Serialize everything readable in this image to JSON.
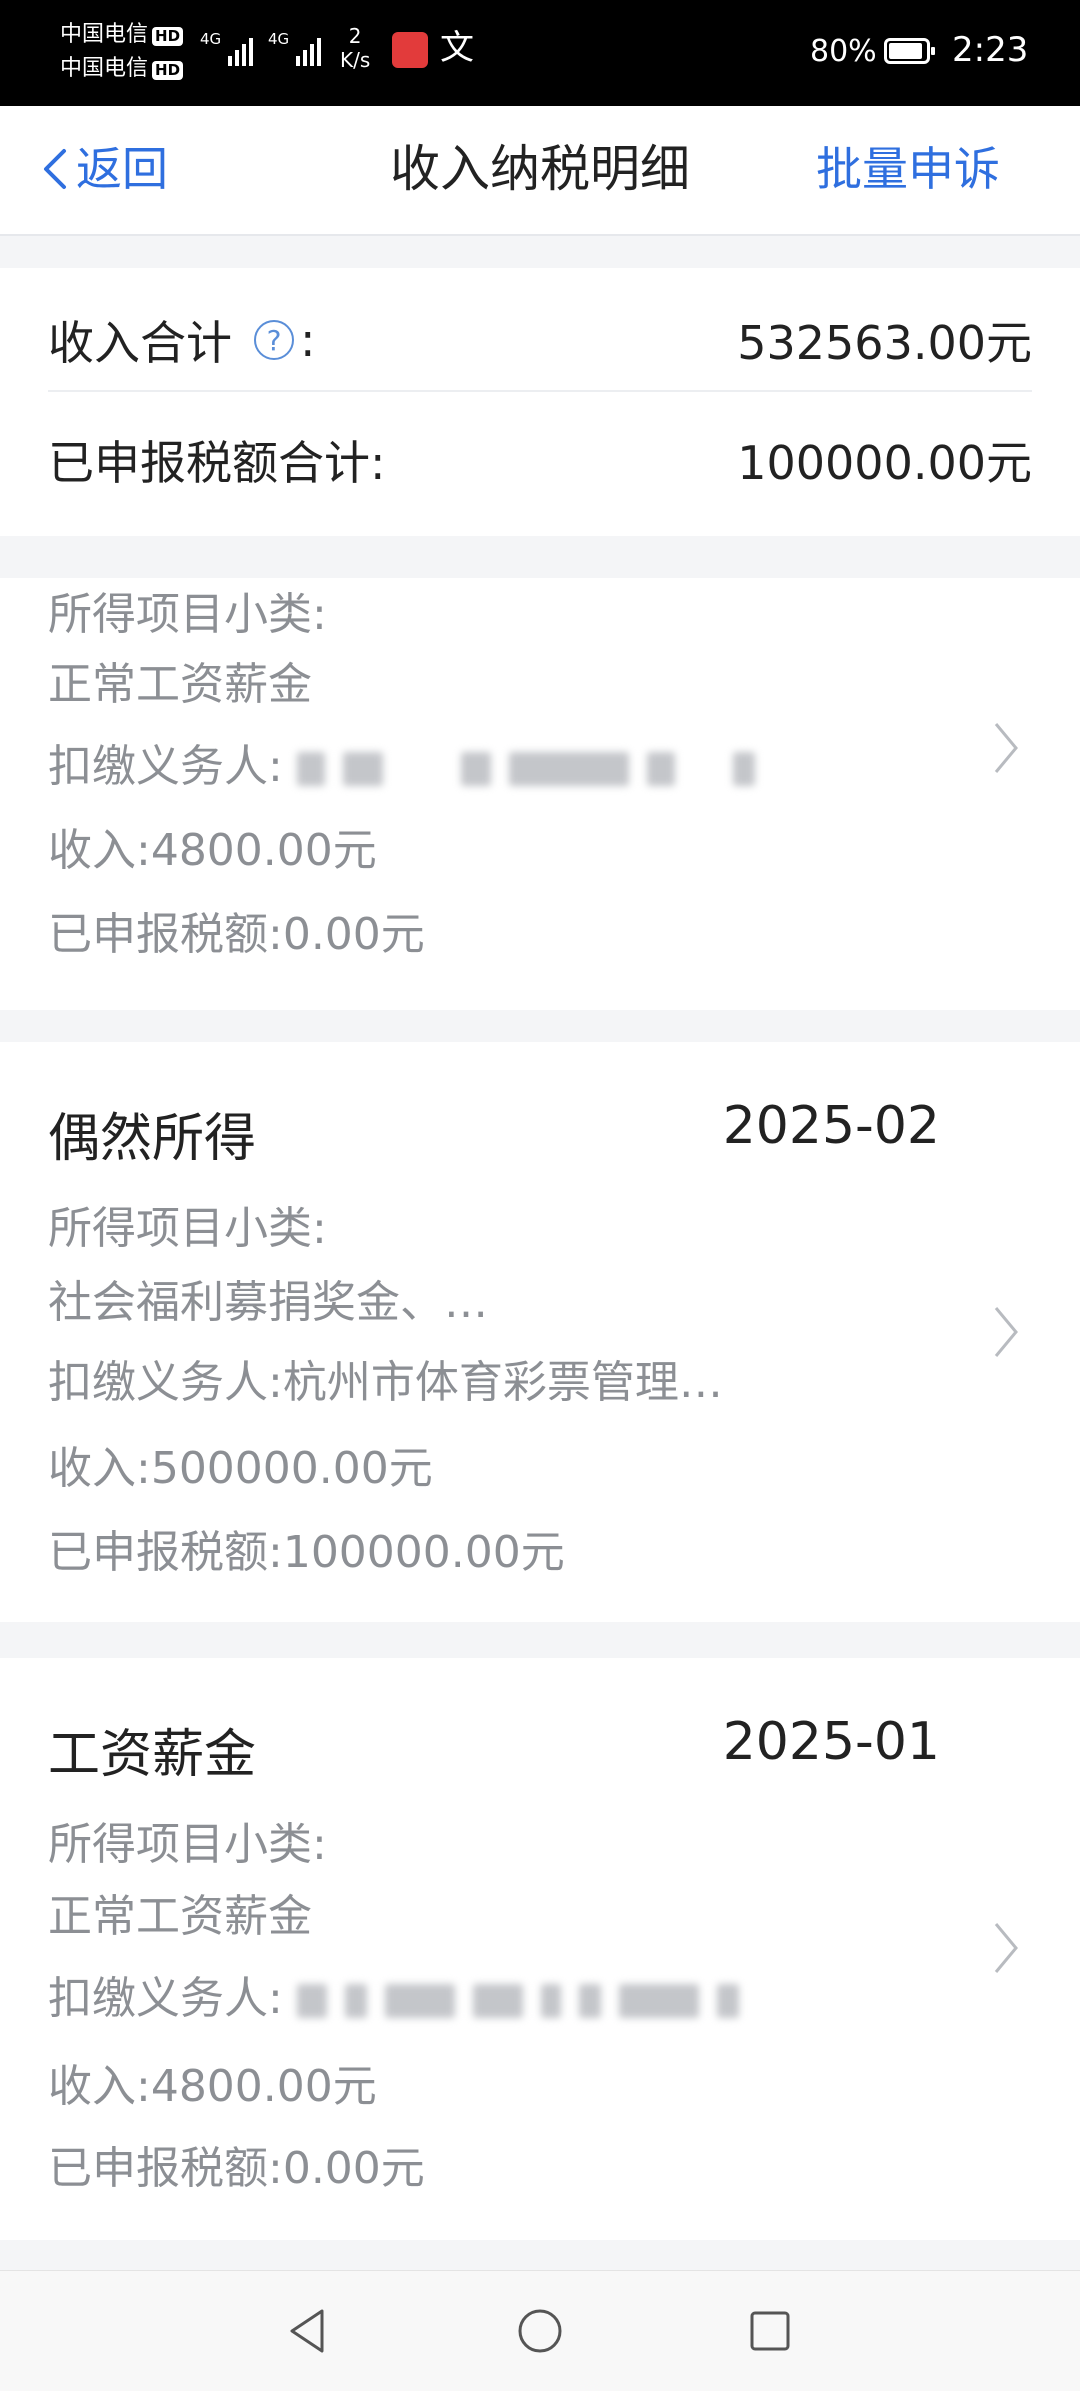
{
  "status_bar": {
    "carrier1": "中国电信",
    "carrier2": "中国电信",
    "hd": "HD",
    "net1": "4G",
    "net2": "4G",
    "speed_value": "2",
    "speed_unit": "K/s",
    "battery_pct": "80%",
    "time": "2:23"
  },
  "header": {
    "back_label": "返回",
    "title": "收入纳税明细",
    "batch_label": "批量申诉"
  },
  "summary": {
    "income_total_label": "收入合计",
    "income_total_suffix": ":",
    "income_total_value": "532563.00元",
    "tax_total_label": "已申报税额合计:",
    "tax_total_value": "100000.00元"
  },
  "records": [
    {
      "category": "",
      "period": "",
      "subcategory_label": "所得项目小类:",
      "subcategory_value": "正常工资薪金",
      "withholder_label": "扣缴义务人:",
      "withholder_value": "",
      "income_line": "收入:4800.00元",
      "tax_line": "已申报税额:0.00元"
    },
    {
      "category": "偶然所得",
      "period": "2025-02",
      "subcategory_label": "所得项目小类:",
      "subcategory_value": "社会福利募捐奖金、…",
      "withholder_label": "扣缴义务人:",
      "withholder_value": "杭州市体育彩票管理…",
      "income_line": "收入:500000.00元",
      "tax_line": "已申报税额:100000.00元"
    },
    {
      "category": "工资薪金",
      "period": "2025-01",
      "subcategory_label": "所得项目小类:",
      "subcategory_value": "正常工资薪金",
      "withholder_label": "扣缴义务人:",
      "withholder_value": "",
      "income_line": "收入:4800.00元",
      "tax_line": "已申报税额:0.00元"
    }
  ],
  "colors": {
    "accent": "#2f6fdf",
    "muted_text": "#8c8f94",
    "background": "#f4f5f7"
  }
}
